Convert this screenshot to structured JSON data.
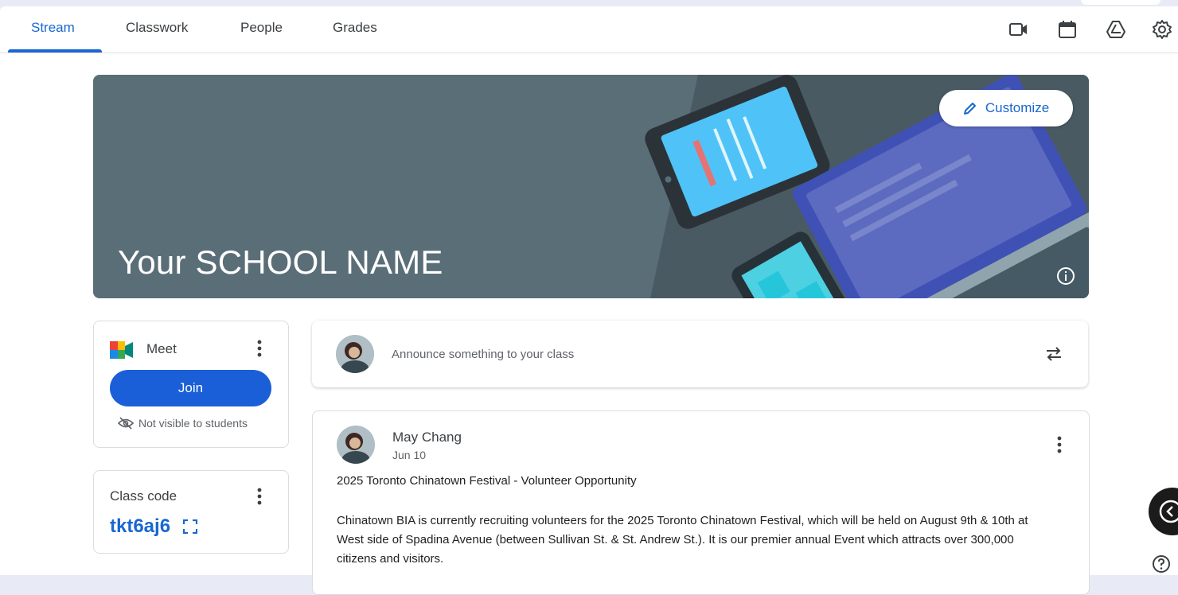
{
  "tabs": [
    {
      "label": "Stream",
      "active": true
    },
    {
      "label": "Classwork",
      "active": false
    },
    {
      "label": "People",
      "active": false
    },
    {
      "label": "Grades",
      "active": false
    }
  ],
  "toolbar_icons": [
    "video-camera-icon",
    "calendar-icon",
    "google-drive-icon",
    "settings-gear-icon"
  ],
  "banner": {
    "title": "Your SCHOOL NAME",
    "customize_label": "Customize",
    "background_color": "#5a6e78"
  },
  "meet": {
    "title": "Meet",
    "join_label": "Join",
    "visibility_note": "Not visible to students"
  },
  "class_code": {
    "label": "Class code",
    "value": "tkt6aj6"
  },
  "announce": {
    "placeholder": "Announce something to your class"
  },
  "post": {
    "author": "May Chang",
    "date": "Jun 10",
    "heading": "2025 Toronto Chinatown Festival - Volunteer Opportunity",
    "body": "Chinatown BIA is currently recruiting volunteers for the 2025 Toronto Chinatown Festival, which will be held on August 9th & 10th at West side of Spadina Avenue (between Sullivan St. & St. Andrew St.). It is our premier annual Event which attracts over 300,000 citizens and visitors."
  },
  "colors": {
    "accent": "#1967d2",
    "join_button": "#1a5fd8",
    "page_background": "#e8eaf6"
  }
}
